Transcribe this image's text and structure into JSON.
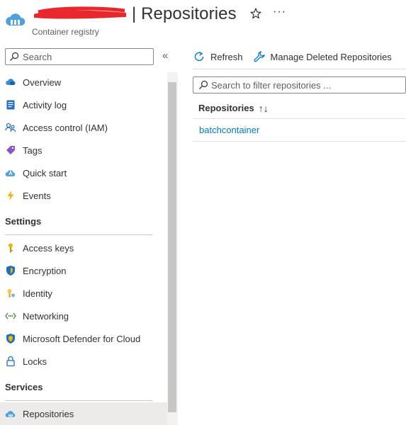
{
  "header": {
    "title": "| Repositories",
    "subtitle": "Container registry",
    "more_label": "···",
    "colors": {
      "redaction": "#e8282d",
      "brand": "#0078d4"
    }
  },
  "sidebar": {
    "search_placeholder": "Search",
    "collapse_label": "«",
    "items_top": [
      {
        "label": "Overview",
        "icon": "cloud-overview-icon"
      },
      {
        "label": "Activity log",
        "icon": "activity-log-icon"
      },
      {
        "label": "Access control (IAM)",
        "icon": "people-iam-icon"
      },
      {
        "label": "Tags",
        "icon": "tag-icon"
      },
      {
        "label": "Quick start",
        "icon": "quickstart-cloud-icon"
      },
      {
        "label": "Events",
        "icon": "lightning-icon"
      }
    ],
    "settings_header": "Settings",
    "items_settings": [
      {
        "label": "Access keys",
        "icon": "key-icon"
      },
      {
        "label": "Encryption",
        "icon": "shield-icon"
      },
      {
        "label": "Identity",
        "icon": "identity-key-icon"
      },
      {
        "label": "Networking",
        "icon": "networking-icon"
      },
      {
        "label": "Microsoft Defender for Cloud",
        "icon": "defender-shield-icon"
      },
      {
        "label": "Locks",
        "icon": "lock-icon"
      }
    ],
    "services_header": "Services",
    "items_services": [
      {
        "label": "Repositories",
        "icon": "repositories-cloud-icon",
        "selected": true
      }
    ]
  },
  "toolbar": {
    "refresh_label": "Refresh",
    "manage_deleted_label": "Manage Deleted Repositories"
  },
  "main": {
    "filter_placeholder": "Search to filter repositories ...",
    "table": {
      "column_header": "Repositories",
      "sort_glyph": "↑↓",
      "rows": [
        {
          "name": "batchcontainer"
        }
      ]
    }
  }
}
